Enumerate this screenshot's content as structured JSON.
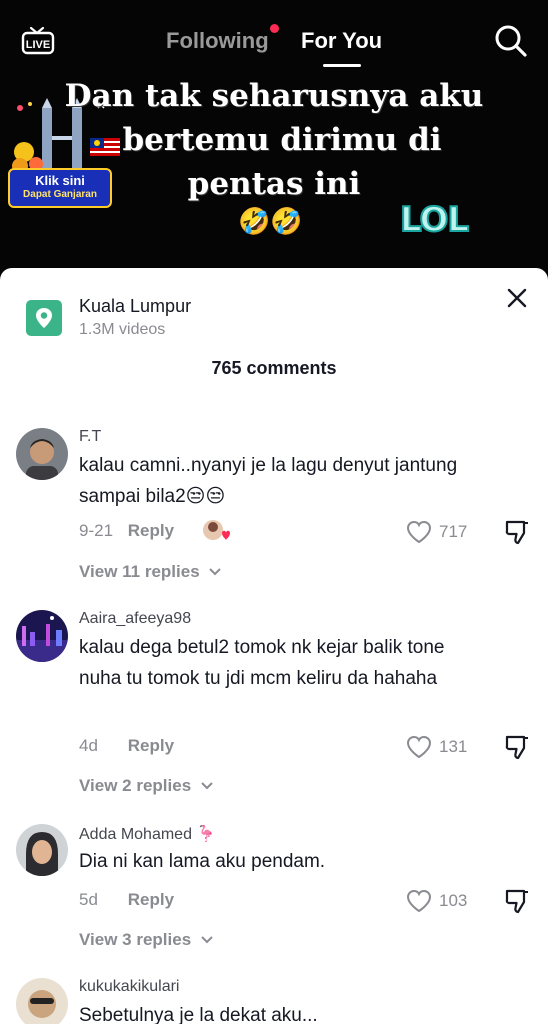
{
  "nav": {
    "live_label": "LIVE",
    "tab_following": "Following",
    "tab_foryou": "For You"
  },
  "video": {
    "caption_line1": "Dan tak seharusnya aku",
    "caption_line2": "bertemu dirimu di",
    "caption_line3": "pentas ini",
    "caption_emoji": "🤣🤣",
    "sticker_text": "LOL",
    "promo_line1": "Klik sini",
    "promo_line2": "Dapat Ganjaran"
  },
  "location": {
    "name": "Kuala Lumpur",
    "videos": "1.3M videos"
  },
  "comments_header": "765 comments",
  "comments": [
    {
      "user": "F.T",
      "text": "kalau camni..nyanyi je la lagu denyut jantung sampai bila2😒😒",
      "date": "9-21",
      "reply": "Reply",
      "likes": "717",
      "view_replies": "View 11 replies"
    },
    {
      "user": "Aaira_afeeya98",
      "text": "kalau dega betul2 tomok nk kejar balik tone nuha tu tomok tu jdi mcm keliru da hahaha",
      "date": "4d",
      "reply": "Reply",
      "likes": "131",
      "view_replies": "View 2 replies"
    },
    {
      "user": "Adda Mohamed 🦩",
      "text": "Dia ni kan lama aku pendam.",
      "date": "5d",
      "reply": "Reply",
      "likes": "103",
      "view_replies": "View 3 replies"
    },
    {
      "user": "kukukakikulari",
      "text": "Sebetulnya je la dekat aku..."
    }
  ],
  "colors": {
    "accent": "#fe2c55",
    "location_icon": "#3cb48a",
    "text_primary": "#161823",
    "text_secondary": "#8a8b91"
  }
}
